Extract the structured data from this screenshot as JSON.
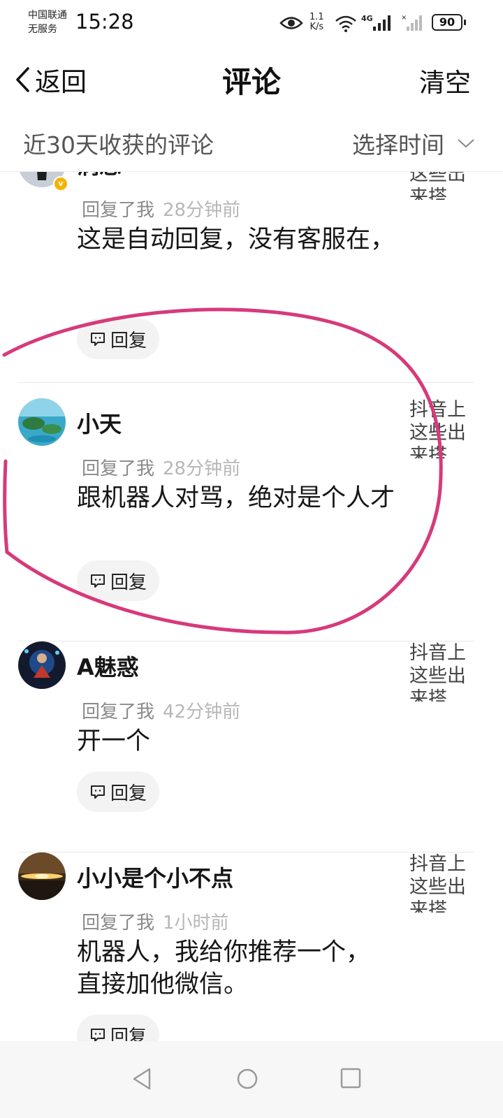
{
  "status_bar": {
    "carrier_line1": "中国联通",
    "carrier_line2": "无服务",
    "time": "15:28",
    "speed_value": "1.1",
    "speed_unit": "K/s",
    "network_type": "4G",
    "battery": "90"
  },
  "nav": {
    "back_label": "返回",
    "title": "评论",
    "clear_label": "清空"
  },
  "filter": {
    "label": "近30天收获的评论",
    "time_select": "选择时间"
  },
  "comments": [
    {
      "username": "涡息",
      "action": "回复了我",
      "ago": "28分钟前",
      "text": "这是自动回复，没有客服在，",
      "reply_label": "回复",
      "video_title": "抖音上这些出来搭",
      "verified": true
    },
    {
      "username": "小天",
      "action": "回复了我",
      "ago": "28分钟前",
      "text": "跟机器人对骂，绝对是个人才",
      "reply_label": "回复",
      "video_title": "抖音上这些出来搭"
    },
    {
      "username": "A魅惑",
      "action": "回复了我",
      "ago": "42分钟前",
      "text": "开一个",
      "reply_label": "回复",
      "video_title": "抖音上这些出来搭"
    },
    {
      "username": "小小是个小不点",
      "action": "回复了我",
      "ago": "1小时前",
      "text": "机器人，我给你推荐一个，直接加他微信。",
      "reply_label": "回复",
      "video_title": "抖音上这些出来搭"
    }
  ],
  "colors": {
    "annotation_circle": "#d63a7a",
    "verified_badge": "#f5b400"
  }
}
